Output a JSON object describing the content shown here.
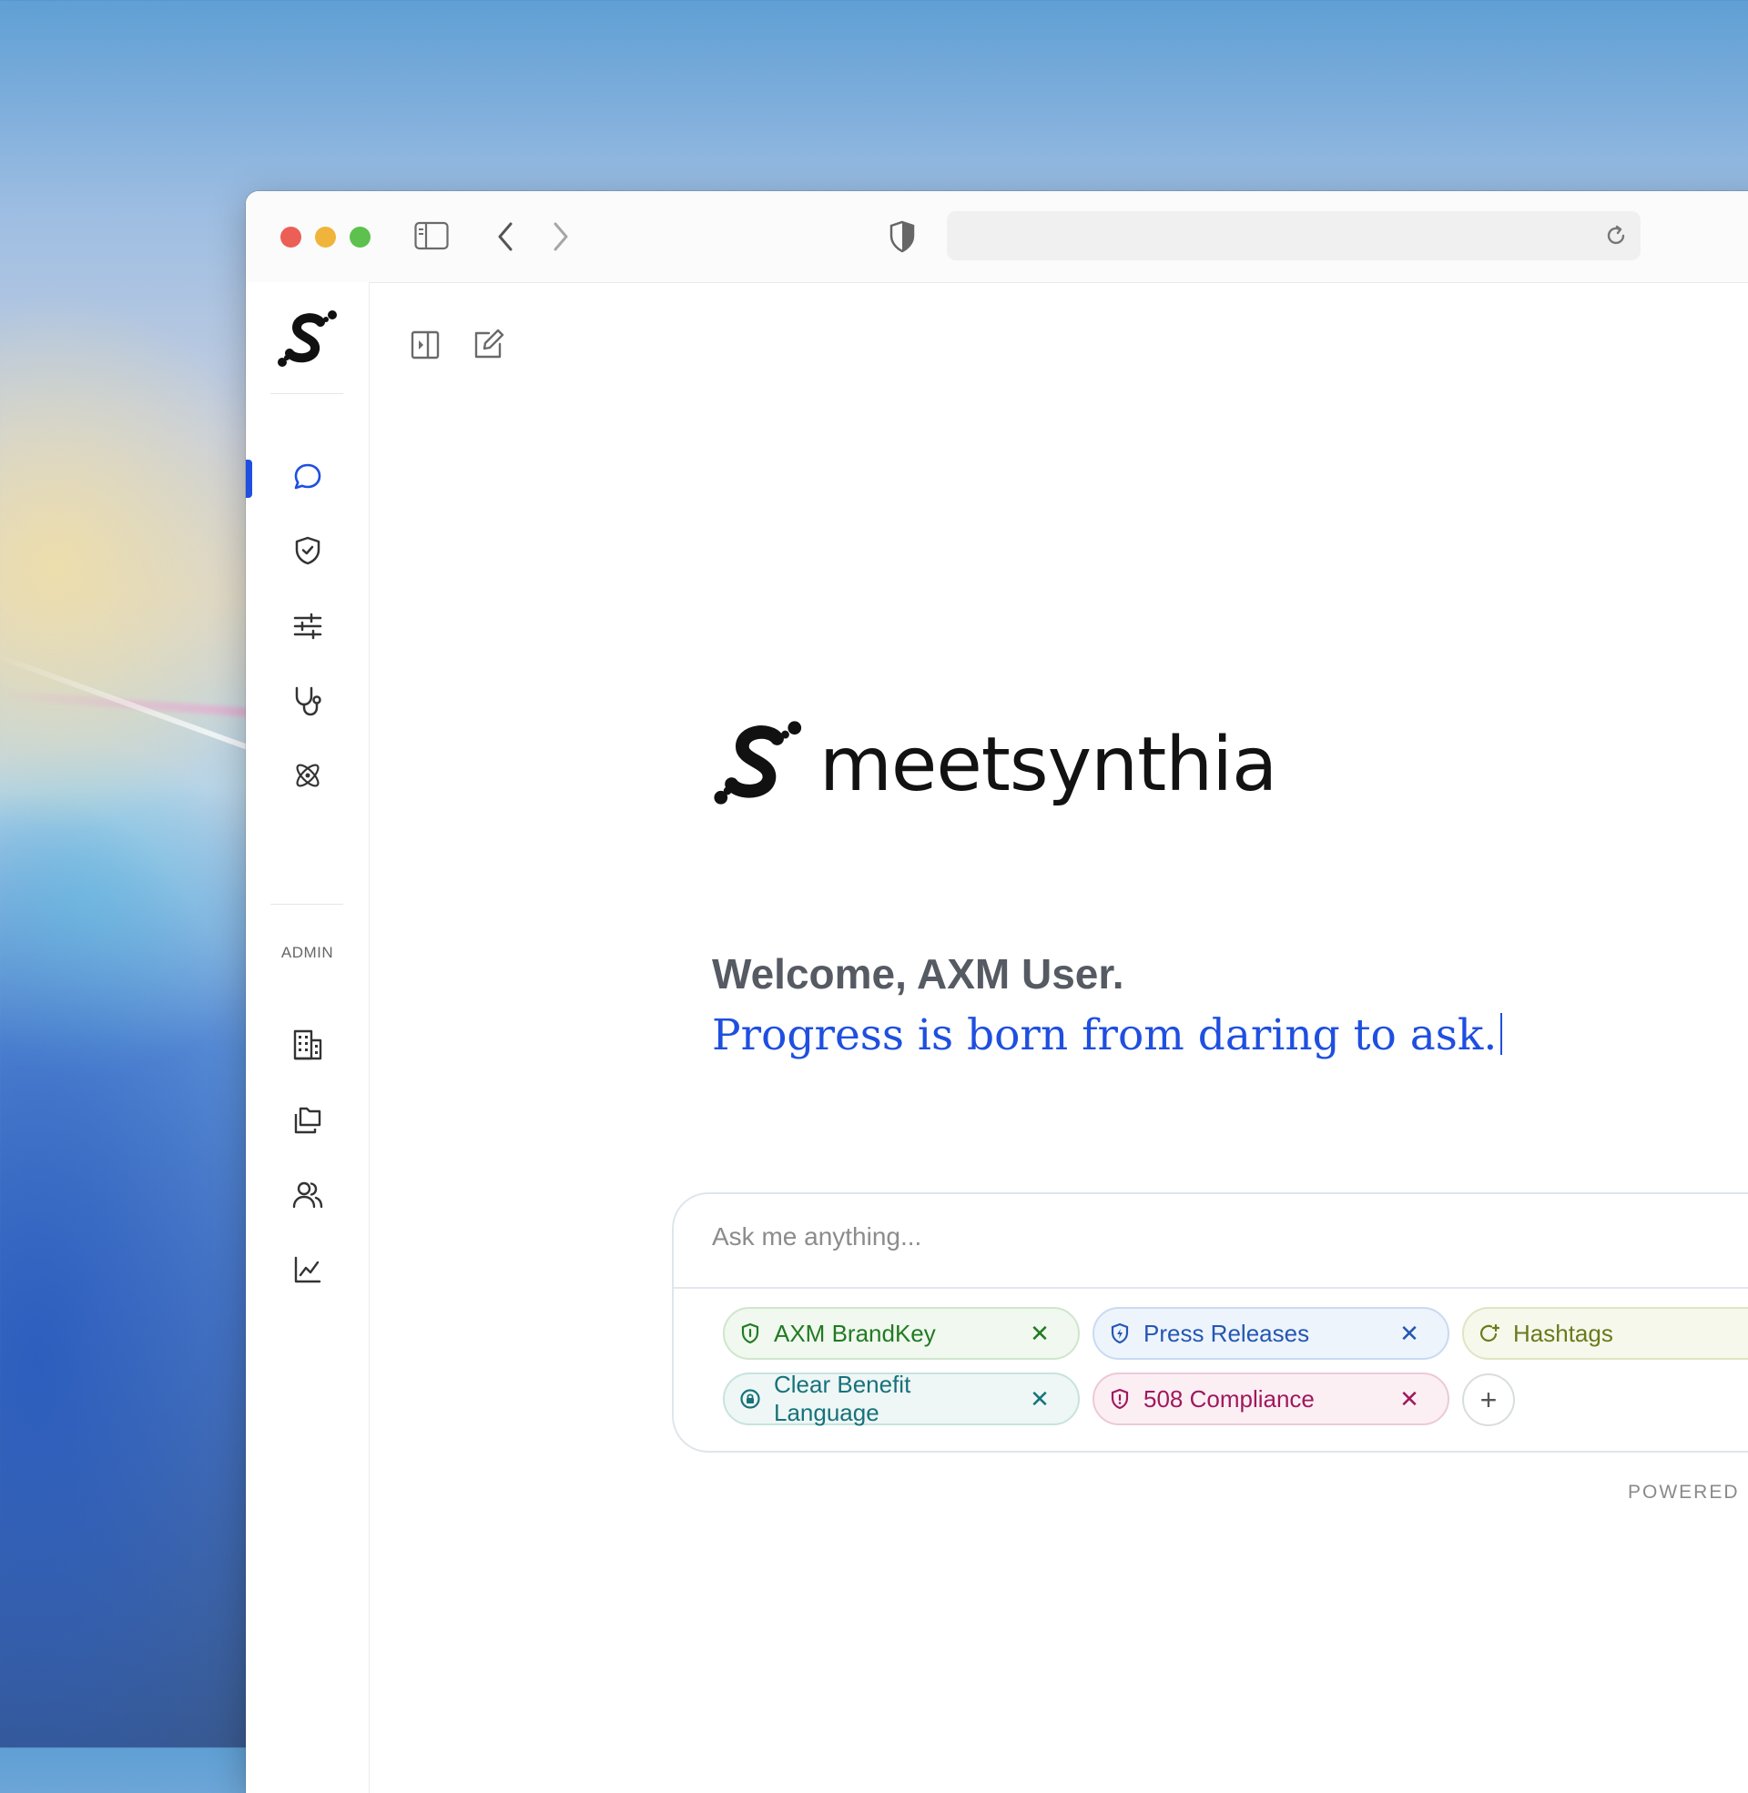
{
  "browser": {
    "url": "",
    "traffic_lights": {
      "close": "#ec5f57",
      "minimize": "#f0b43b",
      "maximize": "#5dc14d"
    },
    "icons": [
      "sidebar-toggle-icon",
      "back-arrow-icon",
      "forward-arrow-icon",
      "privacy-shield-icon",
      "reload-icon"
    ]
  },
  "sidebar": {
    "logo_icon": "synthia-logo-icon",
    "active_color": "#1f4fe0",
    "items": [
      {
        "name": "chat",
        "icon": "chat-bubble-icon",
        "active": true
      },
      {
        "name": "brand-safety",
        "icon": "shield-check-icon"
      },
      {
        "name": "settings",
        "icon": "sliders-icon"
      },
      {
        "name": "health",
        "icon": "stethoscope-icon"
      },
      {
        "name": "science",
        "icon": "atom-icon"
      }
    ],
    "admin_label": "ADMIN",
    "admin_items": [
      {
        "name": "organization",
        "icon": "building-icon"
      },
      {
        "name": "documents",
        "icon": "folders-icon"
      },
      {
        "name": "users",
        "icon": "users-icon"
      },
      {
        "name": "analytics",
        "icon": "line-chart-icon"
      }
    ]
  },
  "toolbar": {
    "icons": [
      "expand-panel-icon",
      "new-chat-icon"
    ]
  },
  "hero": {
    "brand_name": "meetsynthia",
    "welcome": "Welcome, AXM User.",
    "tagline": "Progress is born from daring to ask."
  },
  "chat": {
    "placeholder": "Ask me anything...",
    "chips": [
      {
        "label": "AXM BrandKey",
        "icon": "shield-icon",
        "color": "#227a22"
      },
      {
        "label": "Press Releases",
        "icon": "shield-bolt-icon",
        "color": "#2457b4"
      },
      {
        "label": "Hashtags",
        "icon": "refresh-plus-icon",
        "color": "#6a7a1c"
      },
      {
        "label": "Clear Benefit Language",
        "icon": "lock-badge-icon",
        "color": "#18727a"
      },
      {
        "label": "508 Compliance",
        "icon": "shield-alert-icon",
        "color": "#a0185c"
      }
    ],
    "close_glyph": "✕",
    "add_glyph": "+"
  },
  "footer": {
    "powered_by": "POWERED B"
  }
}
